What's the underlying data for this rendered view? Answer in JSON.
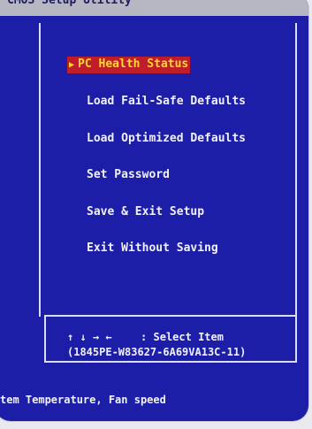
{
  "title_bar": {
    "text": "CMOS Setup Utility"
  },
  "menu": {
    "items": [
      {
        "label": "PC Health Status",
        "selected": true
      },
      {
        "label": "Load Fail-Safe Defaults",
        "selected": false
      },
      {
        "label": "Load Optimized Defaults",
        "selected": false
      },
      {
        "label": "Set Password",
        "selected": false
      },
      {
        "label": "Save & Exit Setup",
        "selected": false
      },
      {
        "label": "Exit Without Saving",
        "selected": false
      }
    ]
  },
  "help": {
    "keys": "↑ ↓ → ←",
    "action": ": Select Item",
    "bios_id": "(1845PE-W83627-6A69VA13C-11)"
  },
  "status_bar": {
    "text": "tem Temperature, Fan speed"
  },
  "colors": {
    "background": "#1d1ea8",
    "selected_bg": "#c01d2a",
    "selected_fg": "#ffd92a",
    "text": "#f1f1f8"
  }
}
